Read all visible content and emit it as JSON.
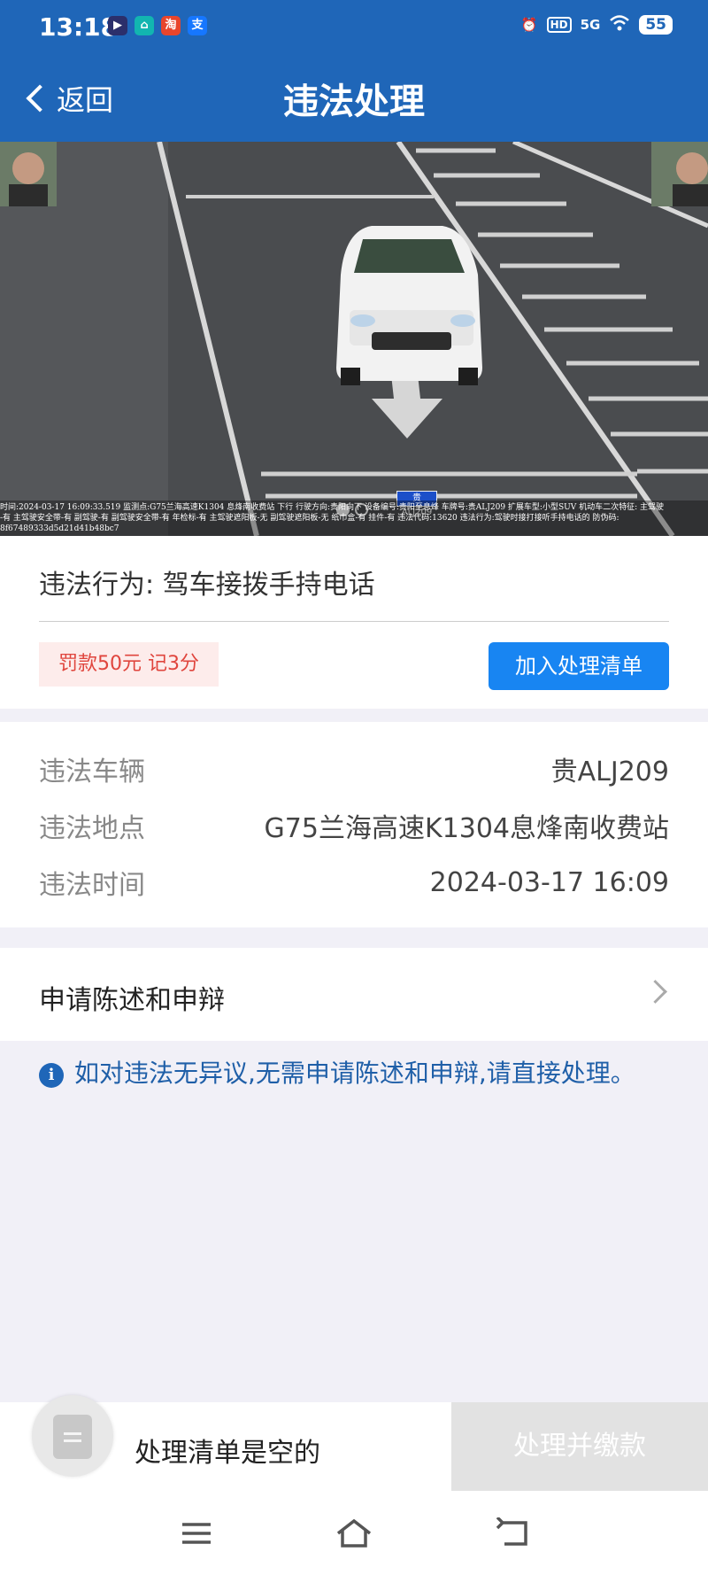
{
  "status_bar": {
    "time": "13:18",
    "network": "5G",
    "hd": "HD",
    "battery": "55",
    "icons": [
      "alarm-icon",
      "hd-icon",
      "signal-5g-icon",
      "wifi-icon",
      "battery-icon"
    ]
  },
  "header": {
    "back_label": "返回",
    "title": "违法处理"
  },
  "photo": {
    "plate": "贵ALJ209",
    "caption_line1": "时间:2024-03-17 16:09:33.519 监测点:G75兰海高速K1304 息烽南收费站 下行 行驶方向:贵阳向下 设备编号:贵阳至息烽 车牌号:贵ALJ209 扩展车型:小型SUV 机动车二次特征: 主驾驶",
    "caption_line2": "-有 主驾驶安全带-有 副驾驶-有 副驾驶安全带-有 年检标-有 主驾驶遮阳板-无 副驾驶遮阳板-无 纸巾盒-有 挂件-有 违法代码:13620 违法行为:驾驶时接打接听手持电话的 防伪码:",
    "caption_line3": "8f67489333d5d21d41b48bc7",
    "slide_count": 2,
    "active_slide": 0
  },
  "violation": {
    "behavior_label": "违法行为:",
    "behavior": "驾车接拨手持电话",
    "penalty": "罚款50元 记3分",
    "add_button": "加入处理清单"
  },
  "details": {
    "vehicle_label": "违法车辆",
    "vehicle": "贵ALJ209",
    "location_label": "违法地点",
    "location": "G75兰海高速K1304息烽南收费站",
    "time_label": "违法时间",
    "time": "2024-03-17 16:09"
  },
  "appeal": {
    "label": "申请陈述和申辩"
  },
  "notice": {
    "text": "如对违法无异议,无需申请陈述和申辩,请直接处理。"
  },
  "action_bar": {
    "cart_text": "处理清单是空的",
    "pay_button": "处理并缴款"
  },
  "colors": {
    "primary": "#1f66b8",
    "button_blue": "#1885f2",
    "penalty_red": "#e0453d",
    "penalty_bg": "#fdeceb",
    "disabled": "#e2e2e2",
    "page_bg": "#f1f0f7"
  }
}
